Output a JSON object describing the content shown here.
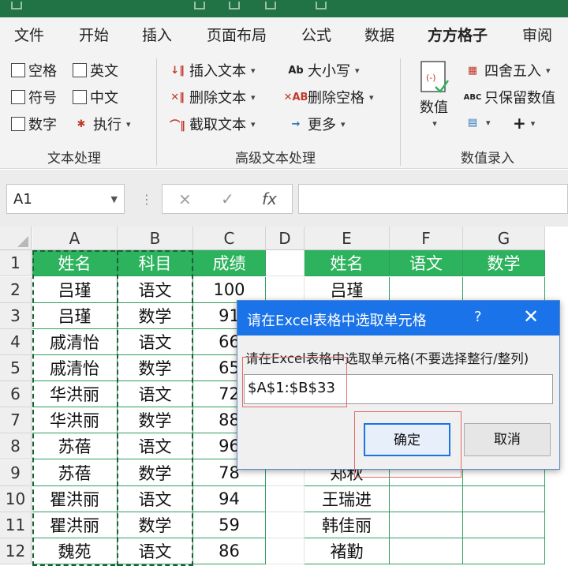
{
  "ribbon": {
    "tabs": [
      "文件",
      "开始",
      "插入",
      "页面布局",
      "公式",
      "数据",
      "方方格子",
      "审阅"
    ],
    "active_tab": "方方格子",
    "text_group": {
      "label": "文本处理",
      "checkboxes": [
        "空格",
        "英文",
        "符号",
        "中文",
        "数字"
      ],
      "execute": "执行"
    },
    "adv_group": {
      "label": "高级文本处理",
      "insert": "插入文本",
      "delete": "删除文本",
      "extract": "截取文本",
      "case": "大小写",
      "del_space": "删除空格",
      "more": "更多"
    },
    "num_group": {
      "label": "数值录入",
      "value": "数值",
      "round": "四舍五入",
      "keep_value": "只保留数值",
      "plus": "+"
    }
  },
  "formula_bar": {
    "name_box": "A1",
    "cancel": "×",
    "confirm": "✓",
    "fx": "fx"
  },
  "grid": {
    "columns": [
      "A",
      "B",
      "C",
      "D",
      "E",
      "F",
      "G"
    ],
    "rows": [
      "1",
      "2",
      "3",
      "4",
      "5",
      "6",
      "7",
      "8",
      "9",
      "10",
      "11",
      "12"
    ],
    "left_header": [
      "姓名",
      "科目",
      "成绩"
    ],
    "left_rows": [
      [
        "吕瑾",
        "语文",
        "100"
      ],
      [
        "吕瑾",
        "数学",
        "91"
      ],
      [
        "戚清怡",
        "语文",
        "66"
      ],
      [
        "戚清怡",
        "数学",
        "65"
      ],
      [
        "华洪丽",
        "语文",
        "72"
      ],
      [
        "华洪丽",
        "数学",
        "88"
      ],
      [
        "苏蓓",
        "语文",
        "96"
      ],
      [
        "苏蓓",
        "数学",
        "78"
      ],
      [
        "瞿洪丽",
        "语文",
        "94"
      ],
      [
        "瞿洪丽",
        "数学",
        "59"
      ],
      [
        "魏苑",
        "语文",
        "86"
      ]
    ],
    "right_header": [
      "姓名",
      "语文",
      "数学"
    ],
    "right_names": [
      "吕瑾",
      "",
      "",
      "",
      "",
      "",
      "",
      "郑秋",
      "王瑞进",
      "韩佳丽",
      "褚勤"
    ]
  },
  "dialog": {
    "title": "请在Excel表格中选取单元格",
    "help": "?",
    "close": "✕",
    "prompt": "请在Excel表格中选取单元格(不要选择整行/整列)",
    "input_value": "$A$1:$B$33",
    "ok": "确定",
    "cancel": "取消"
  },
  "colors": {
    "excel_green": "#217346",
    "header_fill": "#2db35d",
    "dialog_blue": "#1a73e8"
  }
}
